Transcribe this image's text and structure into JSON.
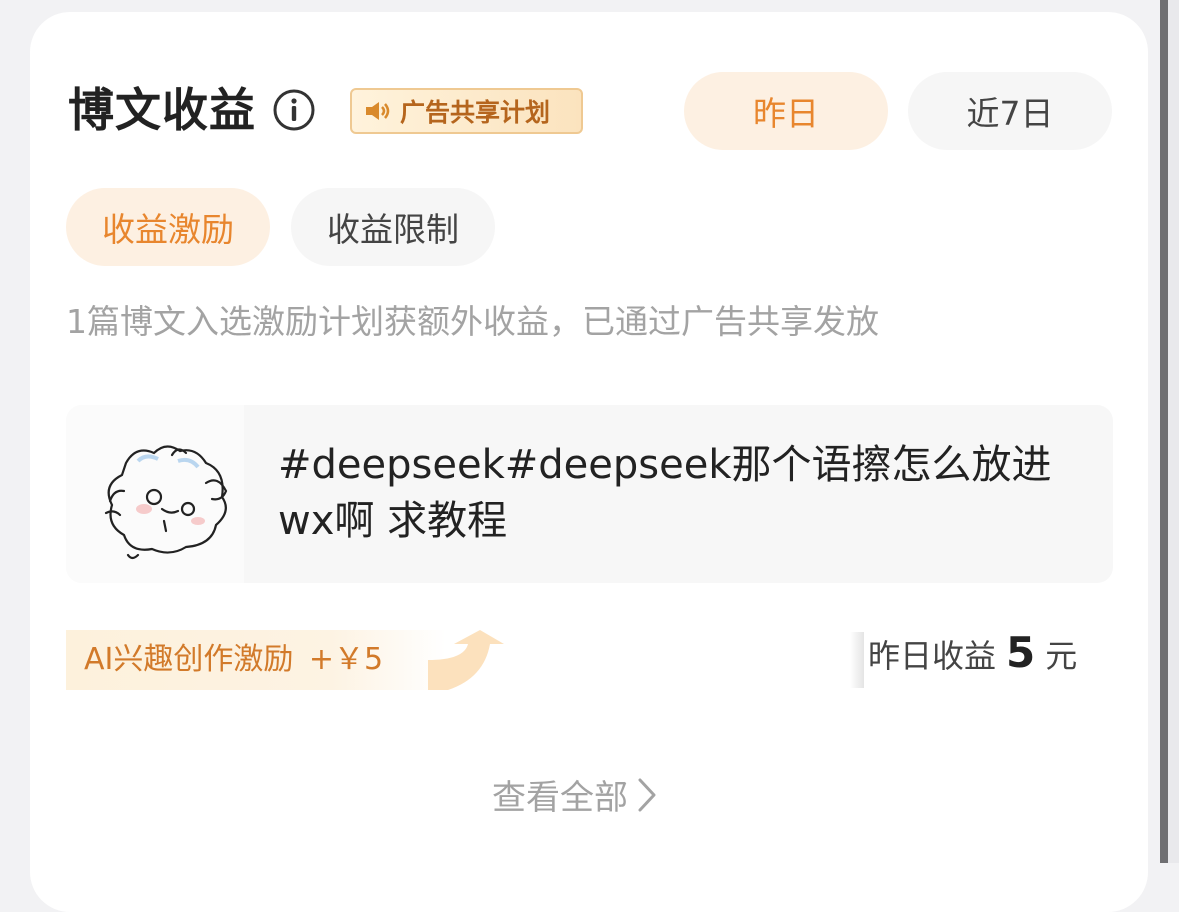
{
  "header": {
    "title": "博文收益",
    "info_icon": "info-circle-icon",
    "ad_badge": {
      "icon": "speaker-icon",
      "label": "广告共享计划"
    },
    "range_tabs": [
      {
        "label": "昨日",
        "active": true
      },
      {
        "label": "近7日",
        "active": false
      }
    ]
  },
  "sub_tabs": [
    {
      "label": "收益激励",
      "active": true
    },
    {
      "label": "收益限制",
      "active": false
    }
  ],
  "description": "1篇博文入选激励计划获额外收益，已通过广告共享发放",
  "post": {
    "thumbnail": "hamster-sketch-avatar",
    "text": "#deepseek#deepseek那个语擦怎么放进wx啊 求教程"
  },
  "reward": {
    "label": "AI兴趣创作激励",
    "amount": "+￥5",
    "icon": "up-arrow-icon"
  },
  "earnings": {
    "label": "昨日收益",
    "value": "5",
    "unit": "元"
  },
  "view_all": {
    "label": "查看全部",
    "icon": "chevron-right-icon"
  },
  "colors": {
    "accent": "#e8862e",
    "accent_bg": "#fdf0e2",
    "muted_text": "#a3a3a3"
  }
}
